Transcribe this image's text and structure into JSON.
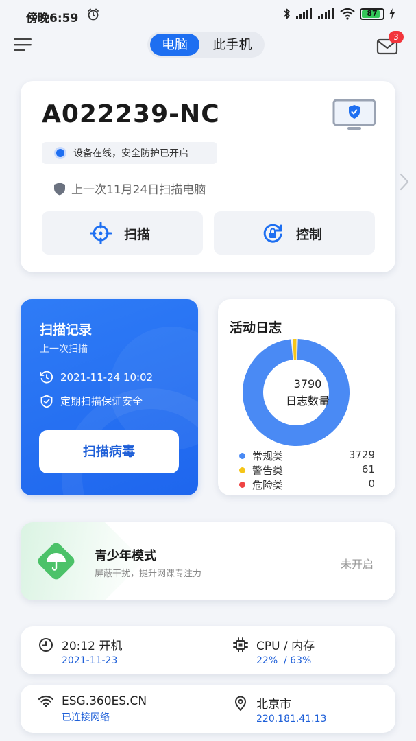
{
  "status_bar": {
    "time": "傍晚6:59",
    "battery_level": "87",
    "icons": [
      "alarm-icon",
      "bluetooth-icon",
      "signal-icon",
      "signal-icon",
      "wifi-icon",
      "battery-icon",
      "charging-icon"
    ]
  },
  "header": {
    "tabs": [
      {
        "label": "电脑",
        "active": true
      },
      {
        "label": "此手机",
        "active": false
      }
    ],
    "mail_badge": "3",
    "accent_color": "#1e6ff1"
  },
  "device": {
    "name": "A022239-NC",
    "status": "设备在线，安全防护已开启",
    "last_scan": "上一次11月24日扫描电脑",
    "actions": [
      {
        "label": "扫描",
        "icon": "crosshair-icon"
      },
      {
        "label": "控制",
        "icon": "remote-control-icon"
      }
    ]
  },
  "scan_record": {
    "title": "扫描记录",
    "subtitle": "上一次扫描",
    "datetime": "2021-11-24 10:02",
    "tip": "定期扫描保证安全",
    "button": "扫描病毒"
  },
  "activity_log": {
    "title": "活动日志",
    "total": "3790",
    "total_label": "日志数量",
    "chart_data": {
      "type": "pie",
      "title": "活动日志",
      "categories": [
        "常规类",
        "警告类",
        "危险类"
      ],
      "values": [
        3729,
        61,
        0
      ],
      "colors": [
        "#4a8af4",
        "#f5c518",
        "#ef4444"
      ]
    }
  },
  "teen_mode": {
    "title": "青少年模式",
    "subtitle": "屏蔽干扰，提升网课专注力",
    "status": "未开启"
  },
  "info": {
    "boot": {
      "main": "20:12 开机",
      "sub": "2021-11-23"
    },
    "cpu": {
      "main": "CPU / 内存",
      "sub": "22%  / 63%"
    },
    "network": {
      "main": "ESG.360ES.CN",
      "sub": "已连接网络"
    },
    "location": {
      "main": "北京市",
      "sub": "220.181.41.13"
    }
  }
}
